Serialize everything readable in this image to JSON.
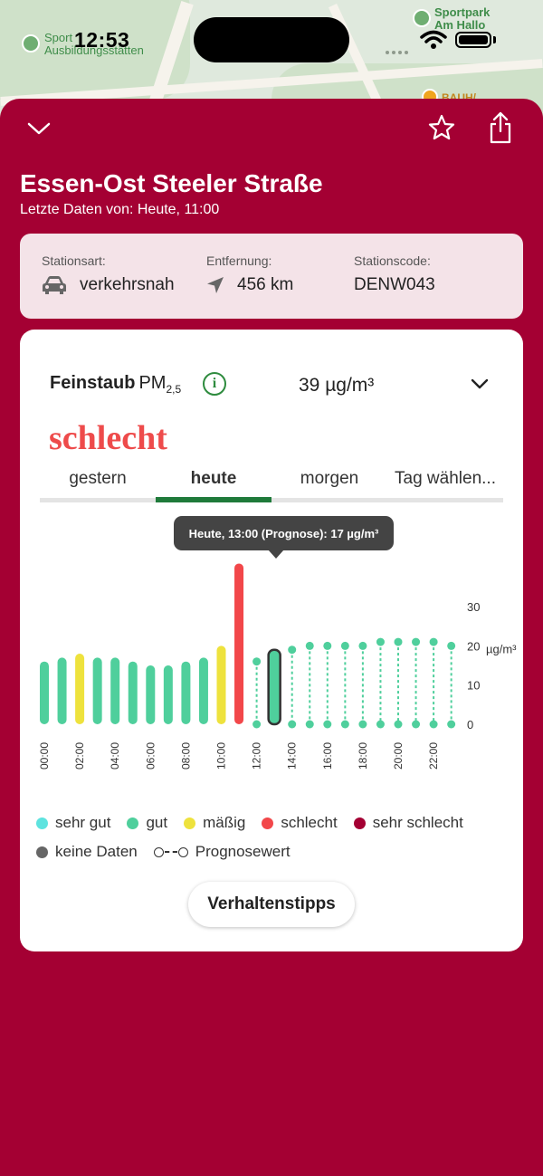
{
  "status_bar": {
    "time": "12:53"
  },
  "map": {
    "labels": [
      {
        "text": "Sport"
      },
      {
        "text": "Ausbildungsstätten"
      },
      {
        "text": "Sportpark"
      },
      {
        "text": "Am Hallo"
      },
      {
        "text": "BAUH/"
      }
    ]
  },
  "sheet": {
    "title": "Essen-Ost Steeler Straße",
    "subtitle": "Letzte Daten von: Heute, 11:00"
  },
  "station": {
    "type_label": "Stationsart:",
    "type_value": "verkehrsnah",
    "distance_label": "Entfernung:",
    "distance_value": "456 km",
    "code_label": "Stationscode:",
    "code_value": "DENW043"
  },
  "measurement": {
    "pollutant": "Feinstaub",
    "pm_base": "PM",
    "pm_sub": "2,5",
    "value": "39 µg/m³",
    "quality": "schlecht",
    "quality_color": "#ee4b4b"
  },
  "tabs": [
    {
      "label": "gestern"
    },
    {
      "label": "heute",
      "active": true
    },
    {
      "label": "morgen"
    },
    {
      "label": "Tag wählen..."
    }
  ],
  "tooltip": "Heute, 13:00 (Prognose): 17 µg/m³",
  "chart_data": {
    "type": "bar",
    "y_ticks": [
      "30",
      "20",
      "10",
      "0"
    ],
    "y_unit": "µg/m³",
    "ylim": [
      0,
      40
    ],
    "x_tick_labels": [
      "00:00",
      "02:00",
      "04:00",
      "06:00",
      "08:00",
      "10:00",
      "12:00",
      "14:00",
      "16:00",
      "18:00",
      "20:00",
      "22:00"
    ],
    "hours": [
      0,
      1,
      2,
      3,
      4,
      5,
      6,
      7,
      8,
      9,
      10,
      11,
      12,
      13,
      14,
      15,
      16,
      17,
      18,
      19,
      20,
      21,
      22,
      23
    ],
    "values": [
      16,
      17,
      18,
      17,
      17,
      16,
      15,
      15,
      16,
      17,
      20,
      41,
      16,
      19,
      19,
      20,
      20,
      20,
      20,
      21,
      21,
      21,
      21,
      20
    ],
    "kind": [
      "measured",
      "measured",
      "measured",
      "measured",
      "measured",
      "measured",
      "measured",
      "measured",
      "measured",
      "measured",
      "measured",
      "measured",
      "forecast",
      "forecast",
      "forecast",
      "forecast",
      "forecast",
      "forecast",
      "forecast",
      "forecast",
      "forecast",
      "forecast",
      "forecast",
      "forecast"
    ],
    "quality": [
      "gut",
      "gut",
      "mäßig",
      "gut",
      "gut",
      "gut",
      "gut",
      "gut",
      "gut",
      "gut",
      "mäßig",
      "schlecht",
      "gut",
      "gut",
      "gut",
      "gut",
      "gut",
      "gut",
      "gut",
      "gut",
      "gut",
      "gut",
      "gut",
      "gut"
    ],
    "selected_index": 13,
    "colors": {
      "sehr gut": "#5ee3df",
      "gut": "#4fcf9c",
      "mäßig": "#eee23d",
      "schlecht": "#f2474a",
      "sehr schlecht": "#a40033",
      "keine Daten": "#666666"
    }
  },
  "legend": {
    "items": [
      {
        "label": "sehr gut",
        "color": "#5ee3df"
      },
      {
        "label": "gut",
        "color": "#4fcf9c"
      },
      {
        "label": "mäßig",
        "color": "#eee23d"
      },
      {
        "label": "schlecht",
        "color": "#f2474a"
      },
      {
        "label": "sehr schlecht",
        "color": "#a40033"
      },
      {
        "label": "keine Daten",
        "color": "#666666"
      }
    ],
    "forecast_label": "Prognosewert"
  },
  "tips_button": "Verhaltenstipps"
}
